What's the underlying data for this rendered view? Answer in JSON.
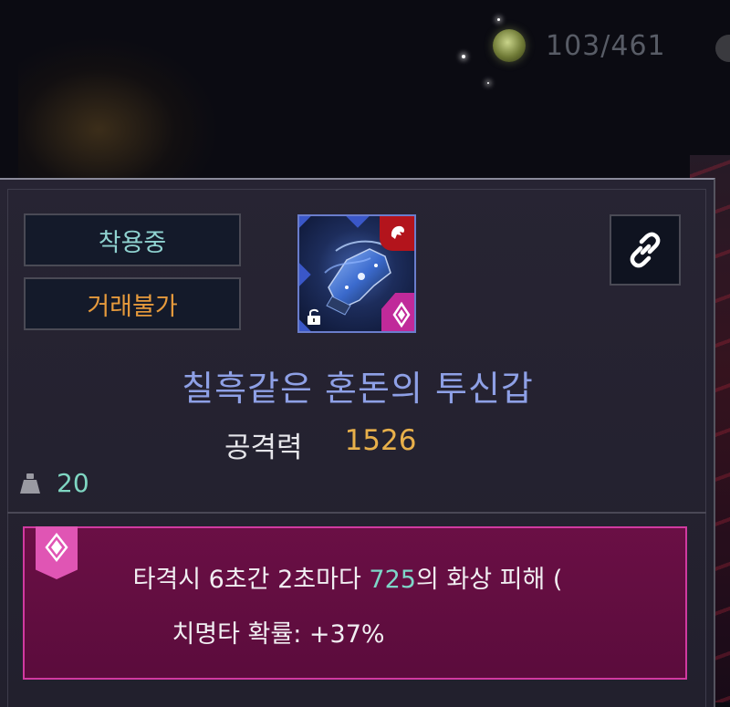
{
  "currency": {
    "icon": "green-gem-icon",
    "count": "103/461"
  },
  "tooltip": {
    "badges": {
      "equipped": "착용중",
      "untradeable": "거래불가"
    },
    "item": {
      "icon": "gauntlet-icon",
      "class_icon": "red-class-emblem-icon",
      "grade_icon": "pink-diamond-grade-icon",
      "lock_icon": "unlock-icon",
      "name": "칠흑같은 혼돈의 투신갑",
      "name_color": "#8ea0e6"
    },
    "link_icon": "link-icon",
    "stat": {
      "label": "공격력",
      "value": "1526"
    },
    "weight": {
      "icon": "weight-icon",
      "value": "20"
    },
    "effect": {
      "tag_icon": "diamond-emblem-icon",
      "line1_prefix": "타격시 6초간 2초마다 ",
      "line1_value": "725",
      "line1_suffix": "의 화상 피해 (",
      "line2": "치명타 확률: +37%"
    }
  },
  "colors": {
    "equipped": "#8fd2d0",
    "untradeable": "#e69a3c",
    "stat_value": "#e8b04a",
    "effect_bg": "#5b0c3c",
    "effect_border": "#d13aa0",
    "highlight": "#7ed6c8"
  }
}
